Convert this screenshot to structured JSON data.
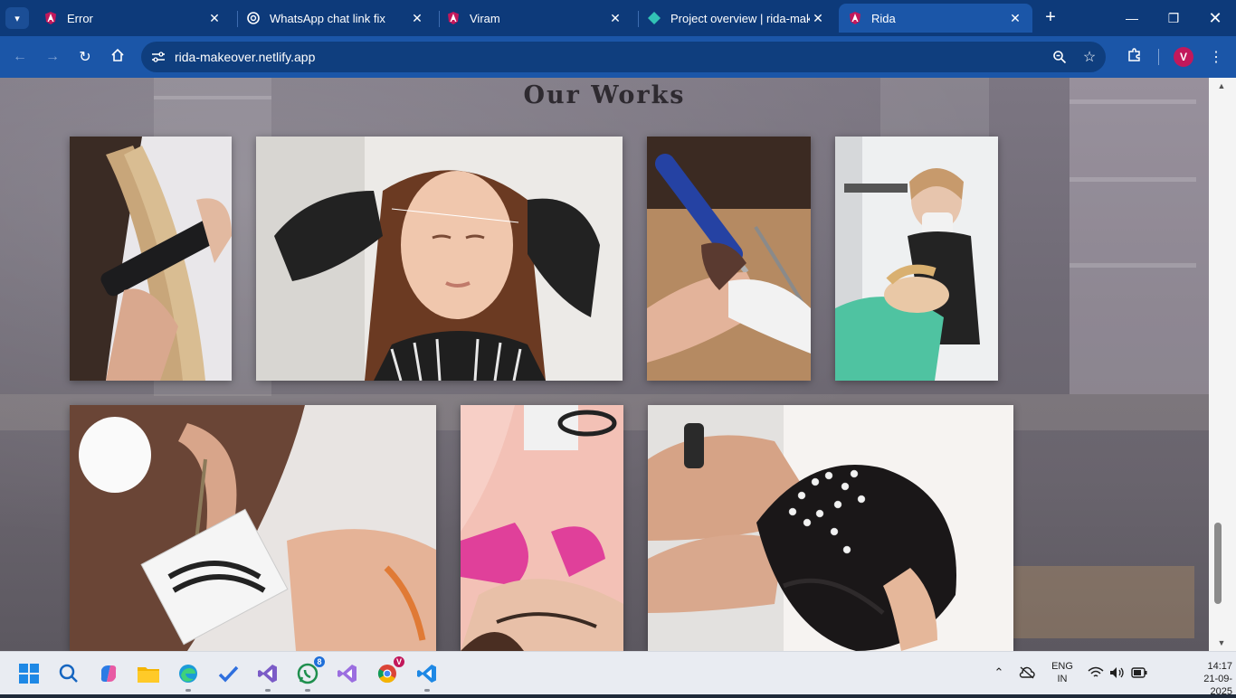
{
  "browser": {
    "tabs": [
      {
        "title": "Error",
        "favicon": "angular-icon"
      },
      {
        "title": "WhatsApp chat link fix",
        "favicon": "openai-icon"
      },
      {
        "title": "Viram",
        "favicon": "angular-icon"
      },
      {
        "title": "Project overview | rida-makeover",
        "favicon": "netlify-icon"
      },
      {
        "title": "Rida",
        "favicon": "angular-icon",
        "active": true
      }
    ],
    "url": "rida-makeover.netlify.app",
    "profile_initial": "V",
    "accent_color": "#1b56a8",
    "tabbar_color": "#0d3a7a"
  },
  "page": {
    "section_title": "Our Works",
    "gallery": [
      {
        "name": "hair-straightening-photo",
        "subject": "hair straightening"
      },
      {
        "name": "eyebrow-threading-photo",
        "subject": "eyebrow threading"
      },
      {
        "name": "nail-drill-manicure-photo",
        "subject": "nail drill manicure"
      },
      {
        "name": "lash-extension-photo",
        "subject": "lash extension"
      },
      {
        "name": "false-lash-tweezer-photo",
        "subject": "false lash application"
      },
      {
        "name": "brow-tinting-photo",
        "subject": "brow tinting"
      },
      {
        "name": "bridal-hair-accessory-photo",
        "subject": "bridal hairstyle"
      }
    ]
  },
  "taskbar": {
    "apps": [
      "start-icon",
      "search-icon",
      "copilot-icon",
      "file-explorer-icon",
      "edge-icon",
      "todo-icon",
      "visual-studio-icon",
      "whatsapp-icon",
      "visual-studio-purple-icon",
      "chrome-icon",
      "vscode-icon"
    ],
    "whatsapp_badge": "8",
    "chrome_badge": "V",
    "language_line1": "ENG",
    "language_line2": "IN",
    "time": "14:17",
    "date": "21-09-2025"
  }
}
